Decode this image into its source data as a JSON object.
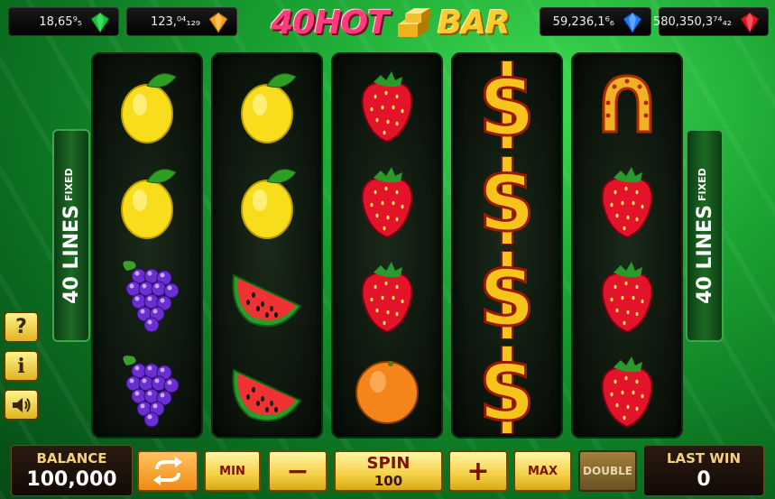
{
  "jackpots": [
    {
      "value": "18,65⁹₅",
      "gem": "green-gem",
      "color": "#17c23a"
    },
    {
      "value": "123,⁰⁴₁₂₉",
      "gem": "orange-gem",
      "color": "#f5a11a"
    },
    {
      "value": "59,236,1⁶₆",
      "gem": "blue-gem",
      "color": "#1c7bff"
    },
    {
      "value": "580,350,3⁷⁴₄₂",
      "gem": "red-gem",
      "color": "#e0141e"
    }
  ],
  "logo": {
    "number": "40",
    "hot": "HOT",
    "bar": "BAR"
  },
  "lines_label": {
    "main": "40 LINES",
    "sub": "FIXED"
  },
  "side_buttons": {
    "help": "?",
    "info": "i",
    "sound": "sound-icon"
  },
  "reels": [
    [
      "lemon",
      "lemon",
      "grapes",
      "grapes"
    ],
    [
      "lemon",
      "lemon",
      "watermelon",
      "watermelon"
    ],
    [
      "strawberry",
      "strawberry",
      "strawberry",
      "orange"
    ],
    [
      "dollar",
      "dollar",
      "dollar",
      "dollar"
    ],
    [
      "horseshoe",
      "strawberry",
      "strawberry",
      "strawberry"
    ]
  ],
  "bottom": {
    "balance_label": "BALANCE",
    "balance_value": "100,000",
    "autoplay_icon": "autoplay-icon",
    "min_label": "MIN",
    "minus_label": "−",
    "spin_label": "SPIN",
    "spin_value": "100",
    "plus_label": "+",
    "max_label": "MAX",
    "double_label": "DOUBLE",
    "lastwin_label": "LAST WIN",
    "lastwin_value": "0"
  }
}
